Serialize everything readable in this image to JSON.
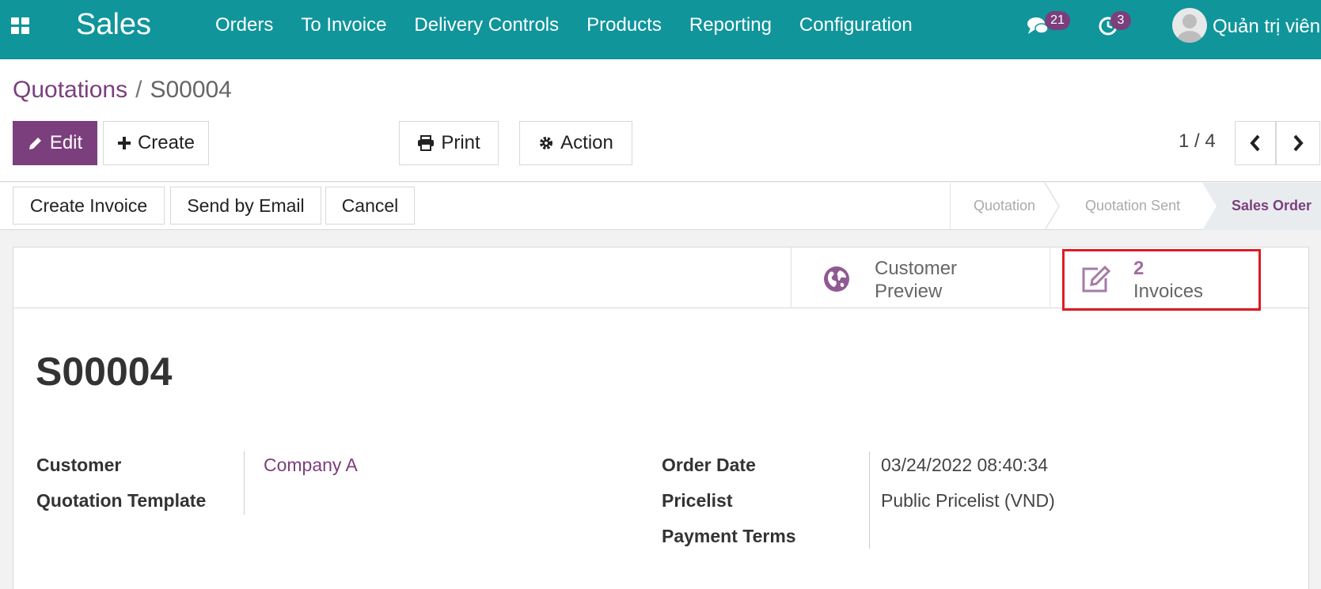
{
  "navbar": {
    "brand": "Sales",
    "menu": [
      "Orders",
      "To Invoice",
      "Delivery Controls",
      "Products",
      "Reporting",
      "Configuration"
    ],
    "messages_count": "21",
    "activities_count": "3",
    "user_name": "Quản trị viên"
  },
  "breadcrumb": {
    "parent": "Quotations",
    "separator": "/",
    "current": "S00004"
  },
  "toolbar": {
    "edit_label": "Edit",
    "create_label": "Create",
    "print_label": "Print",
    "action_label": "Action"
  },
  "pager": {
    "value": "1 / 4"
  },
  "statusbar": {
    "buttons": [
      "Create Invoice",
      "Send by Email",
      "Cancel"
    ],
    "stages": [
      "Quotation",
      "Quotation Sent",
      "Sales Order"
    ],
    "active_stage": "Sales Order"
  },
  "smart_buttons": {
    "customer_preview": {
      "line1": "Customer",
      "line2": "Preview"
    },
    "invoices": {
      "count": "2",
      "label": "Invoices"
    }
  },
  "record": {
    "name": "S00004",
    "customer_label": "Customer",
    "customer_value": "Company A",
    "template_label": "Quotation Template",
    "order_date_label": "Order Date",
    "order_date_value": "03/24/2022 08:40:34",
    "pricelist_label": "Pricelist",
    "pricelist_value": "Public Pricelist (VND)",
    "payment_terms_label": "Payment Terms"
  },
  "colors": {
    "navbar": "#10959b",
    "primary": "#7b3f7d",
    "highlight": "#e01b24"
  }
}
